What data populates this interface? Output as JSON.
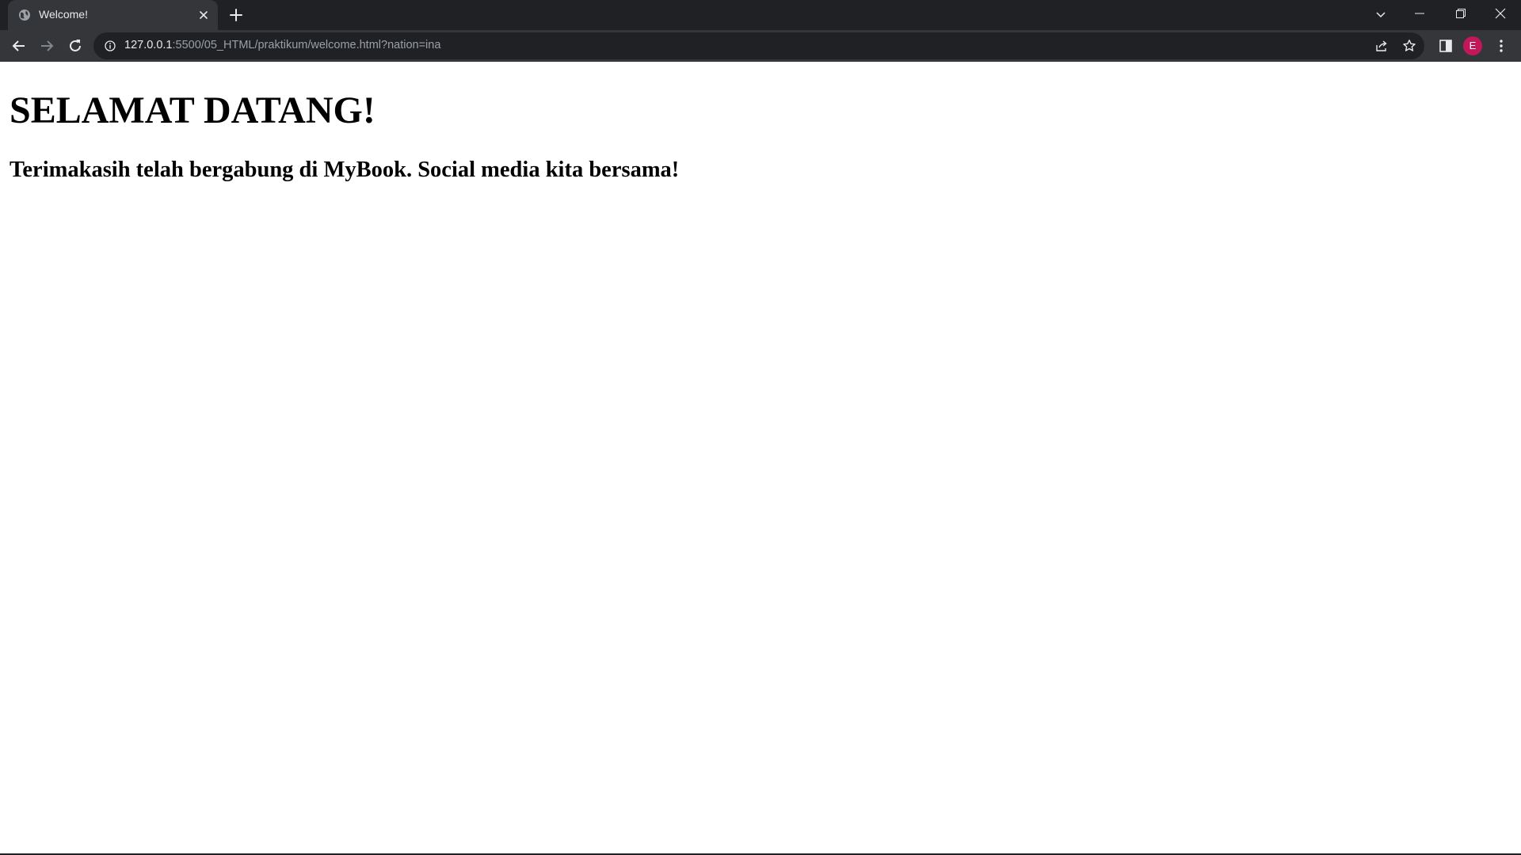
{
  "browser": {
    "tab": {
      "title": "Welcome!",
      "favicon": "globe-icon"
    },
    "address": {
      "host": "127.0.0.1",
      "path": ":5500/05_HTML/praktikum/welcome.html?nation=ina"
    },
    "profile": {
      "initial": "E",
      "color": "#c2185b"
    },
    "icons": {
      "close_tab": "close-icon",
      "new_tab": "plus-icon",
      "tab_search": "chevron-down-icon",
      "minimize": "minimize-icon",
      "restore": "restore-icon",
      "close_window": "close-icon",
      "back": "arrow-left-icon",
      "forward": "arrow-right-icon",
      "reload": "reload-icon",
      "site_info": "info-icon",
      "share": "share-icon",
      "bookmark": "star-icon",
      "side_panel": "side-panel-icon",
      "menu": "more-vert-icon"
    },
    "colors": {
      "frame": "#202124",
      "toolbar": "#35363a",
      "omnibox": "#202124"
    }
  },
  "page": {
    "heading": "SELAMAT DATANG!",
    "subheading": "Terimakasih telah bergabung di MyBook. Social media kita bersama!"
  }
}
